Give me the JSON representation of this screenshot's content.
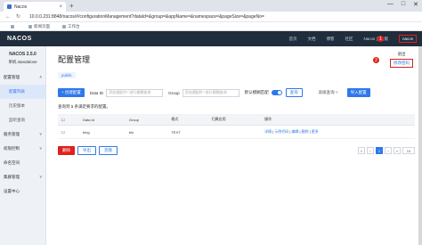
{
  "browser": {
    "tab_title": "Nacos",
    "url": "10.0.0.231:8848/nacos/#/configurationManagement?dataId=&group=&appName=&namespace=&pageSize=&pageNo=",
    "bookmarks": [
      "",
      "新闻页面",
      "工作台"
    ],
    "window_controls": [
      "—",
      "□",
      "✕"
    ]
  },
  "topnav": {
    "logo": "NACOS",
    "links": [
      "首页",
      "文档",
      "博客",
      "社区",
      "Nacos 企业版",
      "nacos"
    ],
    "dropdown": [
      "退出",
      "修改密码"
    ],
    "badges": [
      "1",
      "2"
    ]
  },
  "sidebar": {
    "version": "NACOS 2.5.0",
    "mode": "单机 standalone",
    "groups": [
      {
        "label": "配置管理",
        "items": [
          {
            "label": "配置列表",
            "active": true
          },
          {
            "label": "历史版本"
          },
          {
            "label": "监听查询"
          }
        ]
      },
      {
        "label": "服务管理"
      },
      {
        "label": "权限控制"
      },
      {
        "label": "命名空间"
      },
      {
        "label": "集群管理"
      },
      {
        "label": "设置中心"
      }
    ]
  },
  "main": {
    "title": "配置管理",
    "namespace": "public",
    "filter": {
      "create_btn": "+ 创建配置",
      "dataid_label": "Data ID",
      "dataid_placeholder": "添加通配符'*'进行模糊查询",
      "group_label": "Group",
      "group_placeholder": "添加通配符'*'进行模糊查询",
      "fuzzy_label": "默认模糊匹配",
      "search_btn": "查询",
      "advanced": "高级查询",
      "import_btn": "导入配置"
    },
    "query_note_prefix": "查询到",
    "query_count": "1",
    "query_note_suffix": "条满足要求的配置。",
    "table": {
      "headers": [
        "",
        "Data Id",
        "Group",
        "格式",
        "归属应用",
        "操作"
      ],
      "rows": [
        {
          "data_id": "blog",
          "group": "blo",
          "format": "TEXT",
          "app": "",
          "ops": [
            "详情",
            "示例代码",
            "编辑",
            "删除",
            "更多"
          ]
        }
      ]
    },
    "bottom": {
      "delete_btn": "删除",
      "export_btn": "导出",
      "clone_btn": "克隆",
      "pages": [
        "1"
      ],
      "page_size": "10"
    }
  }
}
